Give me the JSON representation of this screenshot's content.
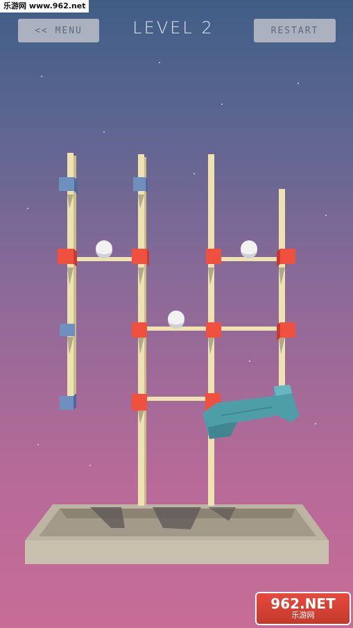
{
  "watermark_top": "乐游网 www.962.net",
  "header": {
    "menu_label": "<< MENU",
    "level_title": "LEVEL 2",
    "restart_label": "RESTART"
  },
  "watermark_bottom": {
    "logo": "962.NET",
    "name": "乐游网"
  },
  "colors": {
    "pole": "#eee3b0",
    "red_node": "#f0503e",
    "blue_node": "#6f8fbe",
    "ball": "#f2f2f2",
    "wrench": "#4e9ea8",
    "base": "#cfc7b7"
  }
}
